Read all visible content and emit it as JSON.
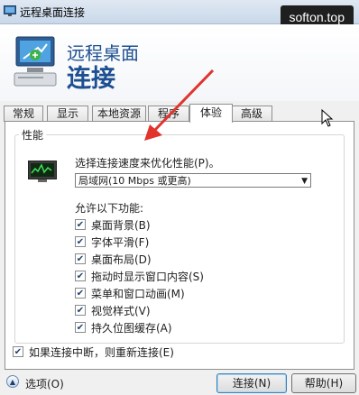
{
  "window": {
    "title": "远程桌面连接"
  },
  "watermark": "softon.top",
  "header": {
    "line1": "远程桌面",
    "line2": "连接"
  },
  "tabs": [
    {
      "label": "常规"
    },
    {
      "label": "显示"
    },
    {
      "label": "本地资源"
    },
    {
      "label": "程序"
    },
    {
      "label": "体验",
      "active": true
    },
    {
      "label": "高级"
    }
  ],
  "performance": {
    "group_title": "性能",
    "select_label": "选择连接速度来优化性能(P)。",
    "select_value": "局域网(10 Mbps 或更高)",
    "allow_label": "允许以下功能:",
    "options": [
      {
        "label": "桌面背景(B)",
        "checked": true
      },
      {
        "label": "字体平滑(F)",
        "checked": true
      },
      {
        "label": "桌面布局(D)",
        "checked": true
      },
      {
        "label": "拖动时显示窗口内容(S)",
        "checked": true
      },
      {
        "label": "菜单和窗口动画(M)",
        "checked": true
      },
      {
        "label": "视觉样式(V)",
        "checked": true
      },
      {
        "label": "持久位图缓存(A)",
        "checked": true
      }
    ]
  },
  "reconnect": {
    "label": "如果连接中断，则重新连接(E)",
    "checked": true
  },
  "footer": {
    "options_label": "选项(O)",
    "connect_label": "连接(N)",
    "help_label": "帮助(H)"
  },
  "colors": {
    "accent": "#1d4f91",
    "annotation_arrow": "#e0342d"
  }
}
